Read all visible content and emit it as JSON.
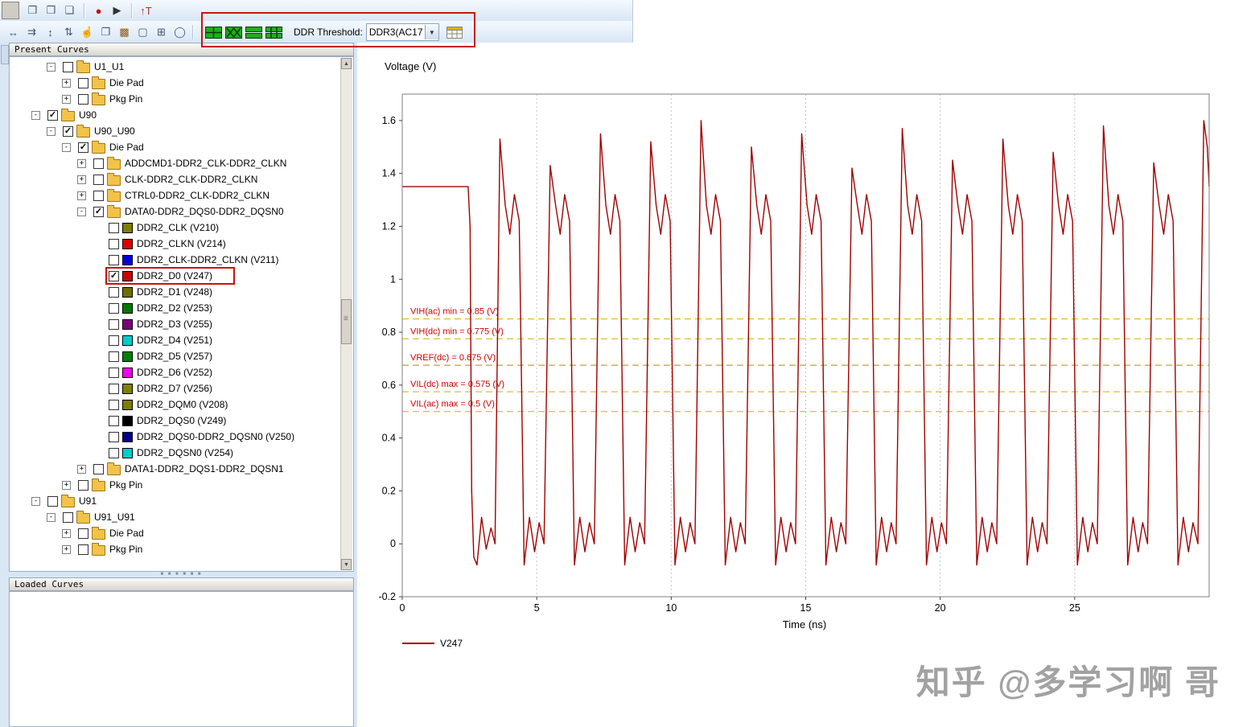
{
  "toolbar_top": {
    "buttons": [
      {
        "name": "new-session",
        "glyph": "❐",
        "color": "#3a5a7a"
      },
      {
        "name": "open-session",
        "glyph": "❒",
        "color": "#3a5a7a"
      },
      {
        "name": "save-session",
        "glyph": "❏",
        "color": "#3a5a7a"
      },
      {
        "name": "record",
        "glyph": "●",
        "color": "#cc1111"
      },
      {
        "name": "run",
        "glyph": "▶",
        "color": "#333333"
      },
      {
        "name": "text-marker",
        "glyph": "↑T",
        "color": "#b03030"
      }
    ]
  },
  "toolbar_main": {
    "buttons": [
      {
        "name": "fit-horizontal",
        "glyph": "↔",
        "color": "#3a5a7a"
      },
      {
        "name": "pan-horizontal",
        "glyph": "⇉",
        "color": "#3a5a7a"
      },
      {
        "name": "fit-vertical",
        "glyph": "↕",
        "color": "#3a5a7a"
      },
      {
        "name": "zoom-vertical",
        "glyph": "⇅",
        "color": "#3a5a7a"
      },
      {
        "name": "pan-tool",
        "glyph": "☝",
        "color": "#7a6a40"
      },
      {
        "name": "copy-view",
        "glyph": "❐",
        "color": "#3a5a7a"
      },
      {
        "name": "color-map",
        "glyph": "▩",
        "color": "#8a5a20"
      },
      {
        "name": "select-region",
        "glyph": "▢",
        "color": "#3a5a7a"
      },
      {
        "name": "grid-select",
        "glyph": "⊞",
        "color": "#3a5a7a"
      },
      {
        "name": "lasso-select",
        "glyph": "◯",
        "color": "#3a5a7a"
      }
    ],
    "view_buttons": [
      {
        "name": "quad-waveform-view"
      },
      {
        "name": "eye-mask-view"
      },
      {
        "name": "stacked-waveform-view"
      },
      {
        "name": "tabular-waveform-view"
      }
    ],
    "ddr_threshold_label": "DDR Threshold:",
    "ddr_threshold_value": "DDR3(AC17"
  },
  "panels": {
    "present_curves_title": "Present Curves",
    "loaded_curves_title": "Loaded Curves"
  },
  "tree": {
    "rows": [
      {
        "type": "folder",
        "depth": 1,
        "expand": "-",
        "checked": false,
        "label": "U1_U1"
      },
      {
        "type": "folder",
        "depth": 2,
        "expand": "+",
        "checked": false,
        "label": "Die Pad"
      },
      {
        "type": "folder",
        "depth": 2,
        "expand": "+",
        "checked": false,
        "label": "Pkg Pin"
      },
      {
        "type": "folder",
        "depth": 0,
        "expand": "-",
        "checked": true,
        "label": "U90"
      },
      {
        "type": "folder",
        "depth": 1,
        "expand": "-",
        "checked": true,
        "label": "U90_U90"
      },
      {
        "type": "folder",
        "depth": 2,
        "expand": "-",
        "checked": true,
        "label": "Die Pad"
      },
      {
        "type": "folder",
        "depth": 3,
        "expand": "+",
        "checked": false,
        "label": "ADDCMD1-DDR2_CLK-DDR2_CLKN"
      },
      {
        "type": "folder",
        "depth": 3,
        "expand": "+",
        "checked": false,
        "label": "CLK-DDR2_CLK-DDR2_CLKN"
      },
      {
        "type": "folder",
        "depth": 3,
        "expand": "+",
        "checked": false,
        "label": "CTRL0-DDR2_CLK-DDR2_CLKN"
      },
      {
        "type": "folder",
        "depth": 3,
        "expand": "-",
        "checked": true,
        "label": "DATA0-DDR2_DQS0-DDR2_DQSN0"
      },
      {
        "type": "leaf",
        "depth": 4,
        "checked": false,
        "color": "#7d7d00",
        "label": "DDR2_CLK (V210)"
      },
      {
        "type": "leaf",
        "depth": 4,
        "checked": false,
        "color": "#dd0000",
        "label": "DDR2_CLKN (V214)"
      },
      {
        "type": "leaf",
        "depth": 4,
        "checked": false,
        "color": "#0000dd",
        "label": "DDR2_CLK-DDR2_CLKN (V211)"
      },
      {
        "type": "leaf",
        "depth": 4,
        "checked": true,
        "color": "#cc0000",
        "label": "DDR2_D0 (V247)",
        "highlight": true
      },
      {
        "type": "leaf",
        "depth": 4,
        "checked": false,
        "color": "#6e6e00",
        "label": "DDR2_D1 (V248)"
      },
      {
        "type": "leaf",
        "depth": 4,
        "checked": false,
        "color": "#007a00",
        "label": "DDR2_D2 (V253)"
      },
      {
        "type": "leaf",
        "depth": 4,
        "checked": false,
        "color": "#7a007a",
        "label": "DDR2_D3 (V255)"
      },
      {
        "type": "leaf",
        "depth": 4,
        "checked": false,
        "color": "#00cccc",
        "label": "DDR2_D4 (V251)"
      },
      {
        "type": "leaf",
        "depth": 4,
        "checked": false,
        "color": "#008000",
        "label": "DDR2_D5 (V257)"
      },
      {
        "type": "leaf",
        "depth": 4,
        "checked": false,
        "color": "#ee00ee",
        "label": "DDR2_D6 (V252)"
      },
      {
        "type": "leaf",
        "depth": 4,
        "checked": false,
        "color": "#808000",
        "label": "DDR2_D7 (V256)"
      },
      {
        "type": "leaf",
        "depth": 4,
        "checked": false,
        "color": "#7d7d00",
        "label": "DDR2_DQM0 (V208)"
      },
      {
        "type": "leaf",
        "depth": 4,
        "checked": false,
        "color": "#000000",
        "label": "DDR2_DQS0 (V249)"
      },
      {
        "type": "leaf",
        "depth": 4,
        "checked": false,
        "color": "#000088",
        "label": "DDR2_DQS0-DDR2_DQSN0 (V250)"
      },
      {
        "type": "leaf",
        "depth": 4,
        "checked": false,
        "color": "#00cccc",
        "label": "DDR2_DQSN0 (V254)"
      },
      {
        "type": "folder",
        "depth": 3,
        "expand": "+",
        "checked": false,
        "label": "DATA1-DDR2_DQS1-DDR2_DQSN1"
      },
      {
        "type": "folder",
        "depth": 2,
        "expand": "+",
        "checked": false,
        "label": "Pkg Pin"
      },
      {
        "type": "folder",
        "depth": 0,
        "expand": "-",
        "checked": false,
        "label": "U91"
      },
      {
        "type": "folder",
        "depth": 1,
        "expand": "-",
        "checked": false,
        "label": "U91_U91"
      },
      {
        "type": "folder",
        "depth": 2,
        "expand": "+",
        "checked": false,
        "label": "Die Pad"
      },
      {
        "type": "folder",
        "depth": 2,
        "expand": "+",
        "checked": false,
        "label": "Pkg Pin"
      }
    ]
  },
  "chart_data": {
    "type": "line",
    "title": "",
    "xlabel": "Time (ns)",
    "ylabel": "Voltage (V)",
    "xlim": [
      0,
      30
    ],
    "ylim": [
      -0.2,
      1.7
    ],
    "xticks": [
      0,
      5,
      10,
      15,
      20,
      25
    ],
    "yticks": [
      -0.2,
      0,
      0.2,
      0.4,
      0.6,
      0.8,
      1,
      1.2,
      1.4,
      1.6
    ],
    "grid": "vertical-dotted",
    "legend_position": "bottom-left",
    "threshold_label_color": "#cc0000",
    "thresholds": [
      {
        "label": "VIH(ac) min = 0.85 (V)",
        "value": 0.85,
        "color": "#d8ae00"
      },
      {
        "label": "VIH(dc) min = 0.775 (V)",
        "value": 0.775,
        "color": "#d8ae00"
      },
      {
        "label": "VREF(dc) = 0.675 (V)",
        "value": 0.675,
        "color": "#b08e00"
      },
      {
        "label": "VIL(dc) max = 0.575 (V)",
        "value": 0.575,
        "color": "#d8ae00"
      },
      {
        "label": "VIL(ac) max = 0.5 (V)",
        "value": 0.5,
        "color": "#d8ae00"
      }
    ],
    "series": [
      {
        "name": "V247",
        "color": "#a00000",
        "points": [
          [
            0,
            1.35
          ],
          [
            2.45,
            1.35
          ],
          [
            2.52,
            1.2
          ],
          [
            2.58,
            0.2
          ],
          [
            2.66,
            -0.05
          ],
          [
            2.78,
            -0.08
          ],
          [
            2.95,
            0.1
          ],
          [
            3.12,
            -0.02
          ],
          [
            3.3,
            0.06
          ],
          [
            3.45,
            0
          ],
          [
            3.63,
            1.53
          ],
          [
            3.83,
            1.28
          ],
          [
            4,
            1.17
          ],
          [
            4.17,
            1.32
          ],
          [
            4.35,
            1.22
          ],
          [
            4.53,
            -0.08
          ],
          [
            4.73,
            0.1
          ],
          [
            4.92,
            -0.03
          ],
          [
            5.09,
            0.08
          ],
          [
            5.27,
            0
          ],
          [
            5.5,
            1.43
          ],
          [
            5.7,
            1.28
          ],
          [
            5.87,
            1.17
          ],
          [
            6.04,
            1.32
          ],
          [
            6.22,
            1.22
          ],
          [
            6.4,
            -0.08
          ],
          [
            6.6,
            0.1
          ],
          [
            6.79,
            -0.03
          ],
          [
            6.96,
            0.08
          ],
          [
            7.14,
            0
          ],
          [
            7.37,
            1.55
          ],
          [
            7.57,
            1.28
          ],
          [
            7.74,
            1.17
          ],
          [
            7.91,
            1.32
          ],
          [
            8.09,
            1.22
          ],
          [
            8.27,
            -0.08
          ],
          [
            8.47,
            0.1
          ],
          [
            8.66,
            -0.03
          ],
          [
            8.83,
            0.08
          ],
          [
            9.01,
            0
          ],
          [
            9.24,
            1.52
          ],
          [
            9.44,
            1.28
          ],
          [
            9.61,
            1.17
          ],
          [
            9.78,
            1.32
          ],
          [
            9.96,
            1.22
          ],
          [
            10.14,
            -0.08
          ],
          [
            10.34,
            0.1
          ],
          [
            10.53,
            -0.03
          ],
          [
            10.7,
            0.08
          ],
          [
            10.88,
            0
          ],
          [
            11.11,
            1.6
          ],
          [
            11.31,
            1.28
          ],
          [
            11.48,
            1.17
          ],
          [
            11.65,
            1.32
          ],
          [
            11.83,
            1.22
          ],
          [
            12.01,
            -0.08
          ],
          [
            12.21,
            0.1
          ],
          [
            12.4,
            -0.03
          ],
          [
            12.57,
            0.08
          ],
          [
            12.75,
            0
          ],
          [
            12.98,
            1.5
          ],
          [
            13.18,
            1.28
          ],
          [
            13.35,
            1.17
          ],
          [
            13.52,
            1.32
          ],
          [
            13.7,
            1.22
          ],
          [
            13.88,
            -0.08
          ],
          [
            14.08,
            0.1
          ],
          [
            14.27,
            -0.03
          ],
          [
            14.44,
            0.08
          ],
          [
            14.62,
            0
          ],
          [
            14.85,
            1.55
          ],
          [
            15.05,
            1.28
          ],
          [
            15.22,
            1.17
          ],
          [
            15.39,
            1.32
          ],
          [
            15.57,
            1.22
          ],
          [
            15.75,
            -0.08
          ],
          [
            15.95,
            0.1
          ],
          [
            16.14,
            -0.03
          ],
          [
            16.31,
            0.08
          ],
          [
            16.49,
            0
          ],
          [
            16.72,
            1.42
          ],
          [
            16.92,
            1.28
          ],
          [
            17.09,
            1.17
          ],
          [
            17.26,
            1.32
          ],
          [
            17.44,
            1.22
          ],
          [
            17.62,
            -0.08
          ],
          [
            17.82,
            0.1
          ],
          [
            18.01,
            -0.03
          ],
          [
            18.18,
            0.08
          ],
          [
            18.36,
            0
          ],
          [
            18.59,
            1.57
          ],
          [
            18.79,
            1.28
          ],
          [
            18.96,
            1.17
          ],
          [
            19.13,
            1.32
          ],
          [
            19.31,
            1.22
          ],
          [
            19.49,
            -0.08
          ],
          [
            19.69,
            0.1
          ],
          [
            19.88,
            -0.03
          ],
          [
            20.05,
            0.08
          ],
          [
            20.23,
            0
          ],
          [
            20.46,
            1.45
          ],
          [
            20.66,
            1.28
          ],
          [
            20.83,
            1.17
          ],
          [
            21,
            1.32
          ],
          [
            21.18,
            1.22
          ],
          [
            21.36,
            -0.08
          ],
          [
            21.56,
            0.1
          ],
          [
            21.75,
            -0.03
          ],
          [
            21.92,
            0.08
          ],
          [
            22.1,
            0
          ],
          [
            22.33,
            1.53
          ],
          [
            22.53,
            1.28
          ],
          [
            22.7,
            1.17
          ],
          [
            22.87,
            1.32
          ],
          [
            23.05,
            1.22
          ],
          [
            23.23,
            -0.08
          ],
          [
            23.43,
            0.1
          ],
          [
            23.62,
            -0.03
          ],
          [
            23.79,
            0.08
          ],
          [
            23.97,
            0
          ],
          [
            24.2,
            1.48
          ],
          [
            24.4,
            1.28
          ],
          [
            24.57,
            1.17
          ],
          [
            24.74,
            1.32
          ],
          [
            24.92,
            1.22
          ],
          [
            25.1,
            -0.08
          ],
          [
            25.3,
            0.1
          ],
          [
            25.49,
            -0.03
          ],
          [
            25.66,
            0.08
          ],
          [
            25.84,
            0
          ],
          [
            26.07,
            1.58
          ],
          [
            26.27,
            1.28
          ],
          [
            26.44,
            1.17
          ],
          [
            26.61,
            1.32
          ],
          [
            26.79,
            1.22
          ],
          [
            26.97,
            -0.08
          ],
          [
            27.17,
            0.1
          ],
          [
            27.36,
            -0.03
          ],
          [
            27.53,
            0.08
          ],
          [
            27.71,
            0
          ],
          [
            27.94,
            1.44
          ],
          [
            28.14,
            1.28
          ],
          [
            28.31,
            1.17
          ],
          [
            28.48,
            1.32
          ],
          [
            28.66,
            1.22
          ],
          [
            28.84,
            -0.08
          ],
          [
            29.04,
            0.1
          ],
          [
            29.23,
            -0.03
          ],
          [
            29.4,
            0.08
          ],
          [
            29.58,
            0
          ],
          [
            29.8,
            1.6
          ],
          [
            29.93,
            1.5
          ],
          [
            30,
            1.35
          ]
        ]
      }
    ]
  },
  "watermark": "知乎 @多学习啊 哥"
}
